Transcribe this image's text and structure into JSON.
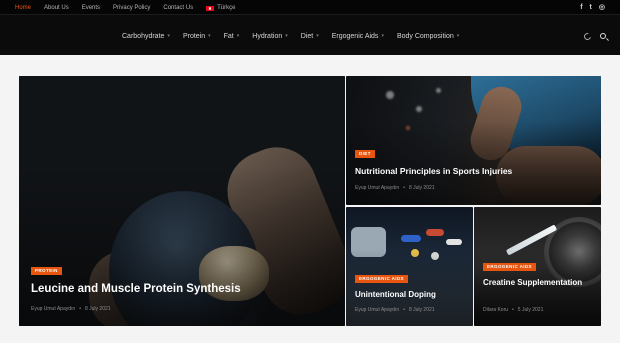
{
  "topbar": {
    "links": [
      "Home",
      "About Us",
      "Events",
      "Privacy Policy",
      "Contact Us",
      "Türkçe"
    ],
    "active": "Home",
    "social": [
      "facebook-icon",
      "twitter-icon",
      "instagram-icon"
    ]
  },
  "nav": {
    "items": [
      "Carbohydrate",
      "Protein",
      "Fat",
      "Hydration",
      "Diet",
      "Ergogenic Aids",
      "Body Composition"
    ]
  },
  "colors": {
    "accent": "#e8550f",
    "header_bg": "#0b0b0c"
  },
  "posts": [
    {
      "category": "PROTEIN",
      "title": "Leucine and Muscle Protein Synthesis",
      "author": "Eyup Umut Apaydın",
      "date": "8 July 2021"
    },
    {
      "category": "DIET",
      "title": "Nutritional Principles in Sports Injuries",
      "author": "Eyup Umut Apaydın",
      "date": "8 July 2021"
    },
    {
      "category": "ERGOGENIC AIDS",
      "title": "Unintentional Doping",
      "author": "Eyup Umut Apaydın",
      "date": "8 July 2021"
    },
    {
      "category": "ERGOGENIC AIDS",
      "title": "Creatine Supplementation",
      "author": "Dilara Koru",
      "date": "5 July 2021"
    }
  ]
}
